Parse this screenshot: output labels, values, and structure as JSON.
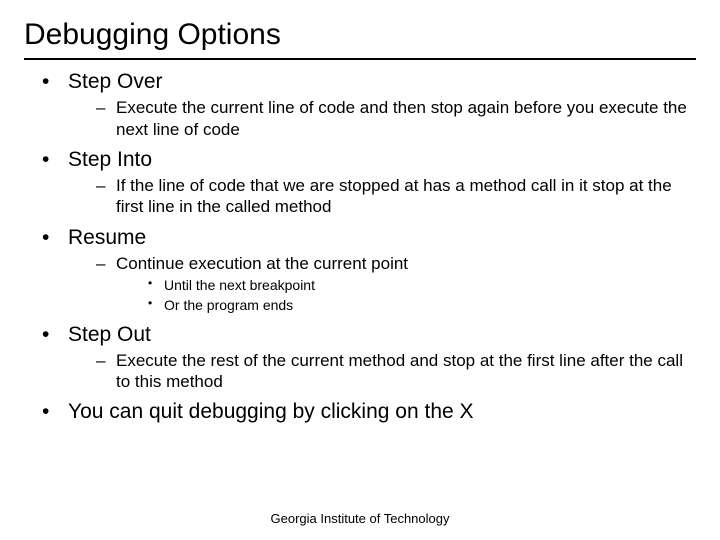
{
  "title": "Debugging Options",
  "bullets": {
    "step_over": {
      "label": "Step Over",
      "desc": "Execute the current line of code and then stop again before you execute the next line of code"
    },
    "step_into": {
      "label": "Step Into",
      "desc": "If the line of code that we are stopped at has a method call in it stop at the first line in the called method"
    },
    "resume": {
      "label": "Resume",
      "desc": "Continue execution at the current point",
      "sub1": "Until the next breakpoint",
      "sub2": "Or the program ends"
    },
    "step_out": {
      "label": "Step Out",
      "desc": "Execute the rest of the current method and stop at the first line after the call to this method"
    },
    "quit": {
      "label": "You can quit debugging by clicking on the X"
    }
  },
  "footer": "Georgia Institute of Technology"
}
